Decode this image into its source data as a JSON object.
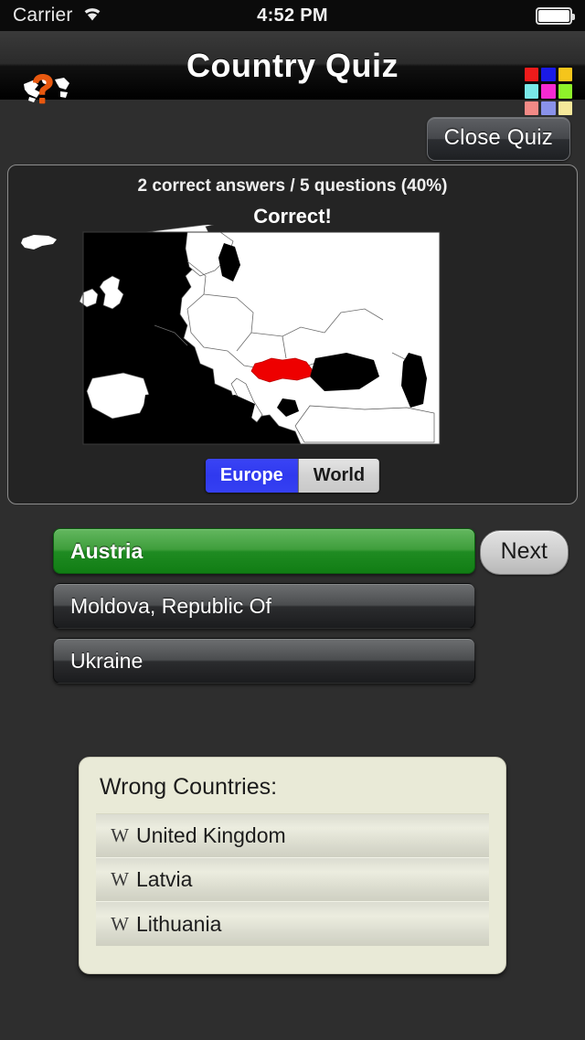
{
  "statusbar": {
    "carrier": "Carrier",
    "wifi_icon": "wifi-icon",
    "time": "4:52 PM",
    "battery_icon": "battery-full-icon"
  },
  "navbar": {
    "title": "Country Quiz",
    "left_icon": "globe-question-mark-icon",
    "right_icon": "color-grid-icon",
    "color_grid": [
      "#ee1b1b",
      "#1a1ae6",
      "#f5c51b",
      "#79e8e8",
      "#f52ad1",
      "#8ef22a",
      "#f28a86",
      "#8a92ea",
      "#f5e89a"
    ]
  },
  "toolbar": {
    "close_quiz_label": "Close Quiz"
  },
  "quiz": {
    "score_line": "2 correct answers / 5 questions (40%)",
    "result_line": "Correct!",
    "correct_count": 2,
    "question_count": 5,
    "percent": "40%",
    "next_label": "Next"
  },
  "map": {
    "region_label": "Europe",
    "highlight_country": "Austria",
    "highlight_color": "#ee0000",
    "land_color": "#ffffff",
    "water_color": "#000000",
    "segments": [
      {
        "label": "Europe",
        "selected": true
      },
      {
        "label": "World",
        "selected": false
      }
    ]
  },
  "answers": [
    {
      "label": "Austria",
      "state": "correct"
    },
    {
      "label": "Moldova, Republic Of",
      "state": "normal"
    },
    {
      "label": "Ukraine",
      "state": "normal"
    }
  ],
  "wrong_countries": {
    "title": "Wrong Countries:",
    "row_icon": "w-letter-icon",
    "items": [
      {
        "label": "United Kingdom",
        "icon_letter": "W"
      },
      {
        "label": "Latvia",
        "icon_letter": "W"
      },
      {
        "label": "Lithuania",
        "icon_letter": "W"
      }
    ]
  }
}
